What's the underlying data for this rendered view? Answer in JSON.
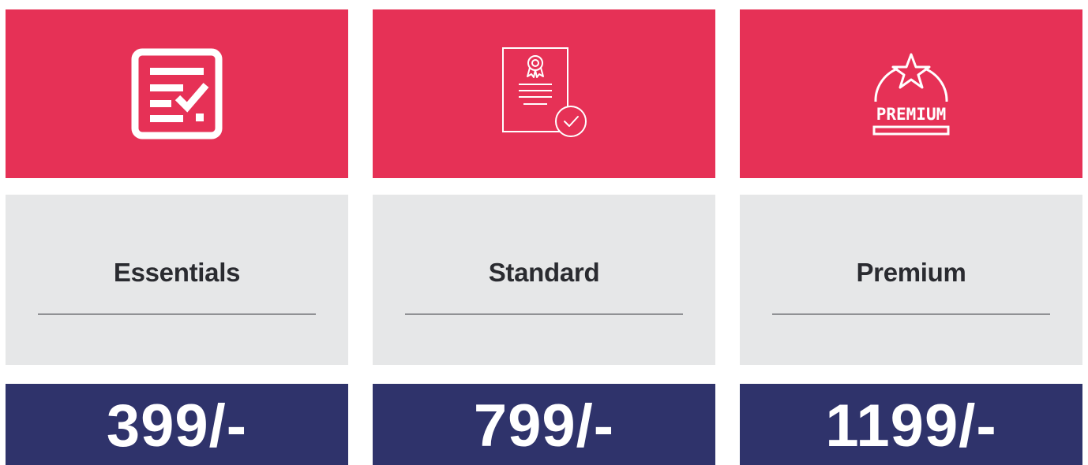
{
  "colors": {
    "accent": "#e63156",
    "panel": "#e6e7e8",
    "price_bg": "#2f336b",
    "text_dark": "#2a2b30"
  },
  "plans": [
    {
      "icon": "checklist-icon",
      "name": "Essentials",
      "price": "399/-"
    },
    {
      "icon": "certificate-icon",
      "name": "Standard",
      "price": "799/-"
    },
    {
      "icon": "premium-badge-icon",
      "name": "Premium",
      "price": "1199/-",
      "icon_text": "PREMIUM"
    }
  ]
}
